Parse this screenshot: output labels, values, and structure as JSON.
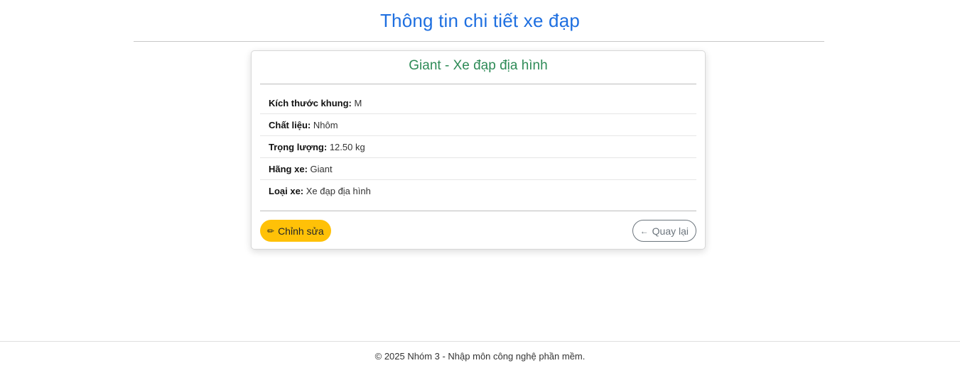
{
  "page": {
    "title": "Thông tin chi tiết xe đạp"
  },
  "card": {
    "title": "Giant - Xe đạp địa hình",
    "details": [
      {
        "label": "Kích thước khung:",
        "value": "M"
      },
      {
        "label": "Chất liệu:",
        "value": "Nhôm"
      },
      {
        "label": "Trọng lượng:",
        "value": "12.50 kg"
      },
      {
        "label": "Hãng xe:",
        "value": "Giant"
      },
      {
        "label": "Loại xe:",
        "value": "Xe đạp địa hình"
      }
    ],
    "actions": {
      "edit_label": "Chỉnh sửa",
      "edit_icon": "pencil-icon",
      "back_label": "Quay lại",
      "back_icon": "arrow-left-icon"
    }
  },
  "footer": {
    "text": "© 2025 Nhóm 3 - Nhập môn công nghệ phần mềm."
  },
  "colors": {
    "title": "#1e6fe0",
    "card_title": "#2e8b57",
    "edit_button": "#ffc107",
    "back_button_border": "#6c757d"
  }
}
